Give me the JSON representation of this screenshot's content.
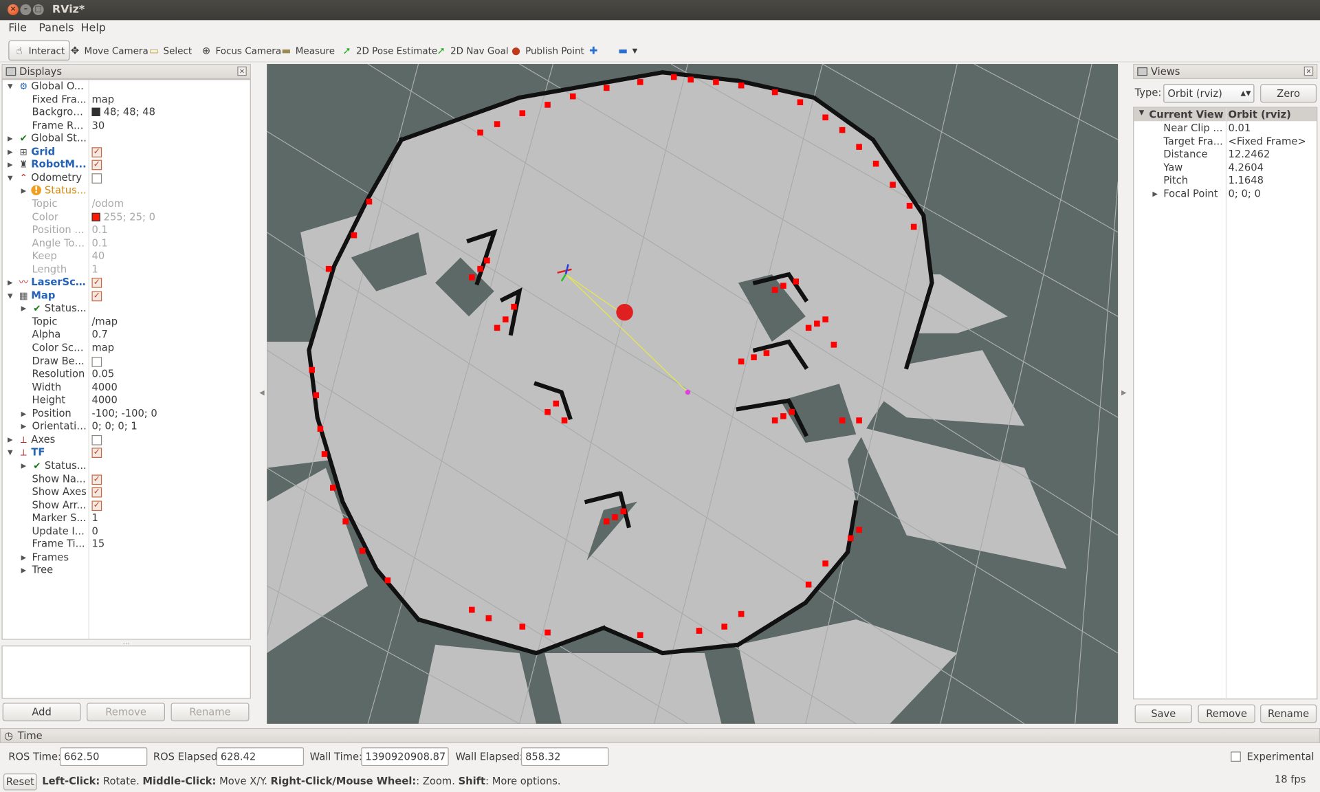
{
  "window": {
    "title": "RViz*"
  },
  "menu": [
    "File",
    "Panels",
    "Help"
  ],
  "toolbar": {
    "tools": [
      {
        "label": "Interact",
        "icon": "hand-icon"
      },
      {
        "label": "Move Camera",
        "icon": "move-camera-icon"
      },
      {
        "label": "Select",
        "icon": "select-icon"
      },
      {
        "label": "Focus Camera",
        "icon": "focus-camera-icon"
      },
      {
        "label": "Measure",
        "icon": "ruler-icon"
      },
      {
        "label": "2D Pose Estimate",
        "icon": "pose-arrow-icon"
      },
      {
        "label": "2D Nav Goal",
        "icon": "goal-arrow-icon"
      },
      {
        "label": "Publish Point",
        "icon": "pin-icon"
      }
    ]
  },
  "displays": {
    "title": "Displays",
    "rows": [
      {
        "label": "Global O...",
        "value": ""
      },
      {
        "label": "Fixed Fra...",
        "value": "map"
      },
      {
        "label": "Backgrou...",
        "value": "48; 48; 48",
        "swatch": "#303030"
      },
      {
        "label": "Frame Rate",
        "value": "30"
      },
      {
        "label": "Global St...",
        "value": ""
      },
      {
        "label": "Grid",
        "value": ""
      },
      {
        "label": "RobotM...",
        "value": ""
      },
      {
        "label": "Odometry",
        "value": ""
      },
      {
        "label": "Status...",
        "value": ""
      },
      {
        "label": "Topic",
        "value": "/odom"
      },
      {
        "label": "Color",
        "value": "255; 25; 0",
        "swatch": "#ff1900"
      },
      {
        "label": "Position ...",
        "value": "0.1"
      },
      {
        "label": "Angle Tol...",
        "value": "0.1"
      },
      {
        "label": "Keep",
        "value": "40"
      },
      {
        "label": "Length",
        "value": "1"
      },
      {
        "label": "LaserScan",
        "value": ""
      },
      {
        "label": "Map",
        "value": ""
      },
      {
        "label": "Status...",
        "value": ""
      },
      {
        "label": "Topic",
        "value": "/map"
      },
      {
        "label": "Alpha",
        "value": "0.7"
      },
      {
        "label": "Color Sch...",
        "value": "map"
      },
      {
        "label": "Draw Be...",
        "value": ""
      },
      {
        "label": "Resolution",
        "value": "0.05"
      },
      {
        "label": "Width",
        "value": "4000"
      },
      {
        "label": "Height",
        "value": "4000"
      },
      {
        "label": "Position",
        "value": "-100; -100; 0"
      },
      {
        "label": "Orientation",
        "value": "0; 0; 0; 1"
      },
      {
        "label": "Axes",
        "value": ""
      },
      {
        "label": "TF",
        "value": ""
      },
      {
        "label": "Status...",
        "value": ""
      },
      {
        "label": "Show Na...",
        "value": ""
      },
      {
        "label": "Show Axes",
        "value": ""
      },
      {
        "label": "Show Arr...",
        "value": ""
      },
      {
        "label": "Marker S...",
        "value": "1"
      },
      {
        "label": "Update I...",
        "value": "0"
      },
      {
        "label": "Frame Ti...",
        "value": "15"
      },
      {
        "label": "Frames",
        "value": ""
      },
      {
        "label": "Tree",
        "value": ""
      }
    ],
    "buttons": {
      "add": "Add",
      "remove": "Remove",
      "rename": "Rename"
    }
  },
  "views": {
    "title": "Views",
    "type_label": "Type:",
    "type_value": "Orbit (rviz)",
    "zero": "Zero",
    "header": {
      "name": "Current View",
      "value": "Orbit (rviz)"
    },
    "rows": [
      {
        "label": "Near Clip ...",
        "value": "0.01"
      },
      {
        "label": "Target Fra...",
        "value": "<Fixed Frame>"
      },
      {
        "label": "Distance",
        "value": "12.2462"
      },
      {
        "label": "Yaw",
        "value": "4.2604"
      },
      {
        "label": "Pitch",
        "value": "1.1648"
      },
      {
        "label": "Focal Point",
        "value": "0; 0; 0"
      }
    ],
    "buttons": {
      "save": "Save",
      "remove": "Remove",
      "rename": "Rename"
    }
  },
  "time": {
    "title": "Time",
    "ros_time_label": "ROS Time:",
    "ros_time": "662.50",
    "ros_elapsed_label": "ROS Elapsed:",
    "ros_elapsed": "628.42",
    "wall_time_label": "Wall Time:",
    "wall_time": "1390920908.87",
    "wall_elapsed_label": "Wall Elapsed:",
    "wall_elapsed": "858.32",
    "experimental": "Experimental"
  },
  "status": {
    "reset": "Reset",
    "h1": "Left-Click:",
    "t1": " Rotate. ",
    "h2": "Middle-Click:",
    "t2": " Move X/Y. ",
    "h3": "Right-Click/Mouse Wheel:",
    "t3": ": Zoom. ",
    "h4": "Shift",
    "t4": ": More options.",
    "fps": "18 fps"
  },
  "colors": {
    "viewport_bg": "#5c6966",
    "free": "#c0c0c0",
    "obstacle": "#111111",
    "laser": "#ff0000"
  }
}
